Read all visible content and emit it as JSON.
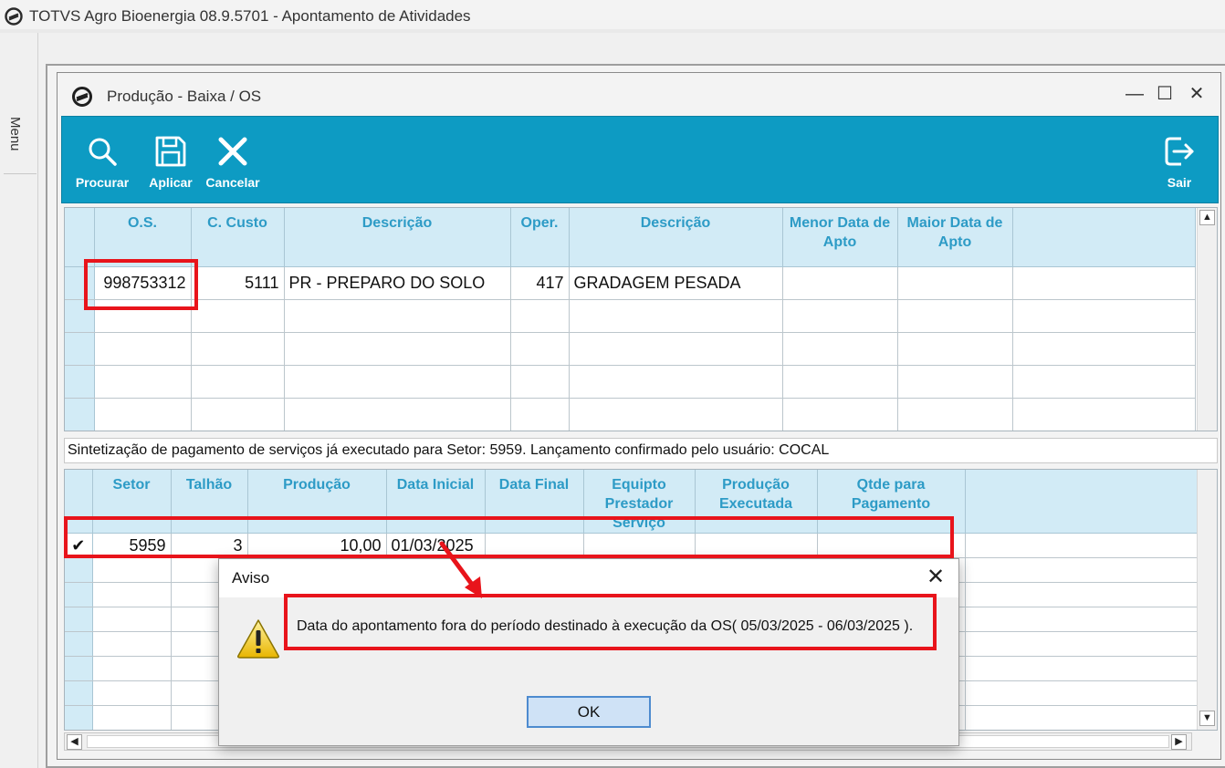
{
  "app": {
    "title": "TOTVS Agro Bioenergia 08.9.5701 - Apontamento de Atividades",
    "menu_label": "Menu"
  },
  "window": {
    "title": "Produção - Baixa / OS",
    "min_glyph": "—",
    "max_glyph": "☐",
    "close_glyph": "✕"
  },
  "toolbar": {
    "search": {
      "label": "Procurar",
      "icon": "search-icon"
    },
    "apply": {
      "label": "Aplicar",
      "icon": "save-icon"
    },
    "cancel": {
      "label": "Cancelar",
      "icon": "close-icon"
    },
    "exit": {
      "label": "Sair",
      "icon": "exit-icon"
    },
    "color": "#0d9bc3"
  },
  "os_grid": {
    "columns": [
      "O.S.",
      "C. Custo",
      "Descrição",
      "Oper.",
      "Descrição",
      "Menor Data de Apto",
      "Maior Data de Apto"
    ],
    "rows": [
      [
        "998753312",
        "5111",
        "PR - PREPARO DO SOLO",
        "417",
        "GRADAGEM PESADA",
        "",
        ""
      ]
    ]
  },
  "status_text": "Sintetização de pagamento de serviços já executado para Setor:  5959. Lançamento confirmado pelo usuário: COCAL",
  "prod_grid": {
    "columns": [
      "Setor",
      "Talhão",
      "Produção",
      "Data Inicial",
      "Data Final",
      "Equipto Prestador Serviço",
      "Produção Executada",
      "Qtde para Pagamento"
    ],
    "rows": [
      {
        "checked": true,
        "check_glyph": "✔",
        "values": [
          "5959",
          "3",
          "10,00",
          "01/03/2025",
          "",
          "",
          "",
          ""
        ]
      }
    ]
  },
  "dialog": {
    "title": "Aviso",
    "icon": "warning-icon",
    "message": "Data do apontamento fora do período destinado à execução da OS( 05/03/2025 - 06/03/2025 ).",
    "ok_label": "OK",
    "close_glyph": "✕"
  },
  "colors": {
    "highlight": "#e8141b",
    "header_bg": "#d2ebf6",
    "header_text": "#2d9bc6"
  }
}
